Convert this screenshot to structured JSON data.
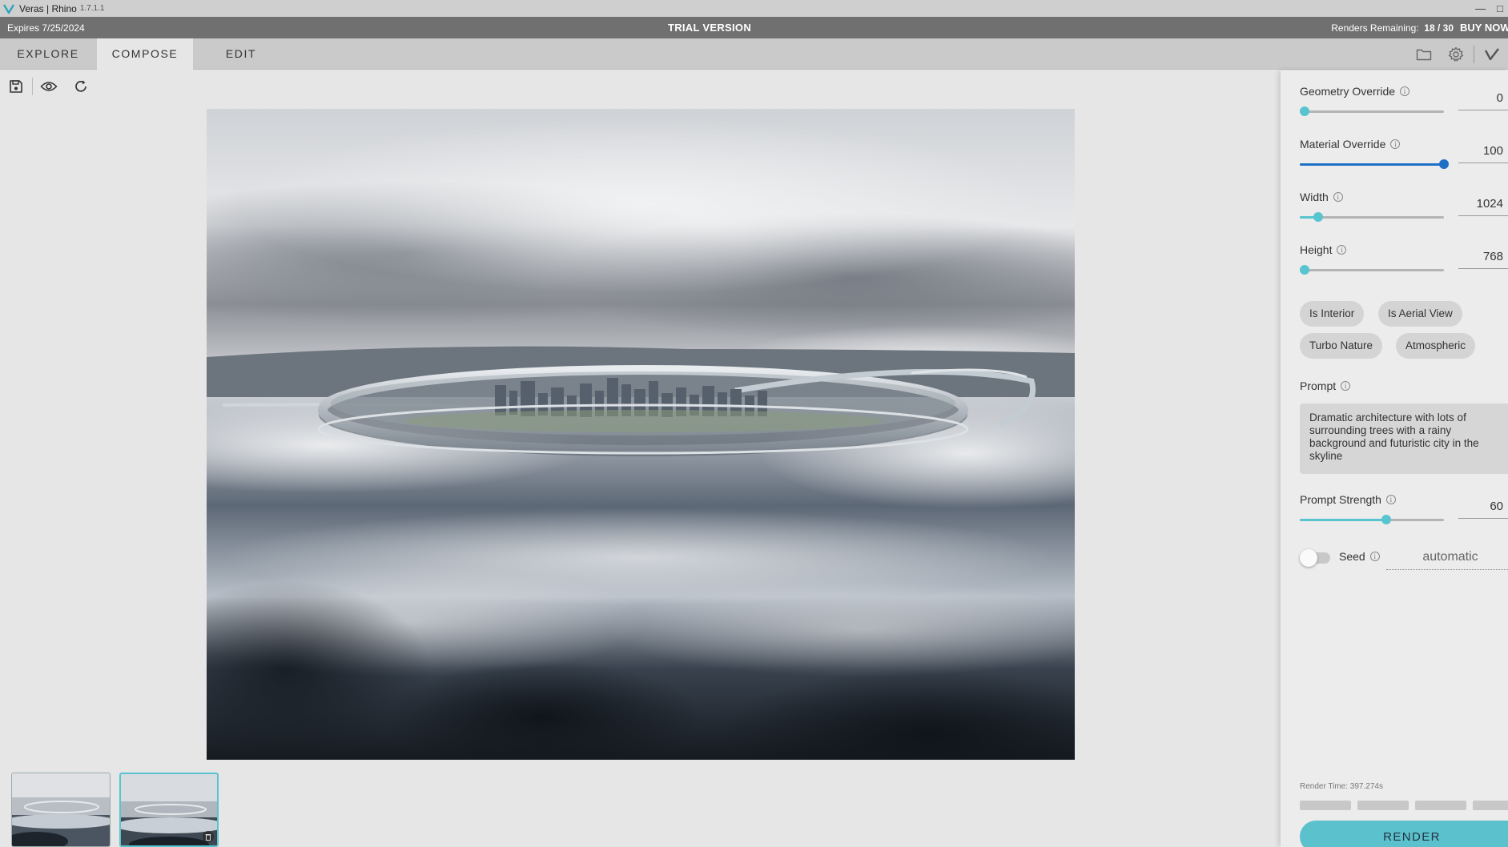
{
  "window": {
    "app_title": "Veras | Rhino",
    "app_version": "1.7.1.1",
    "minimize_glyph": "—",
    "maximize_glyph": "□"
  },
  "trial_bar": {
    "expires": "Expires 7/25/2024",
    "trial_label": "TRIAL VERSION",
    "renders_label": "Renders Remaining:",
    "renders_value": "18 / 30",
    "buy_now": "BUY NOW"
  },
  "tabs": [
    {
      "label": "EXPLORE",
      "active": false
    },
    {
      "label": "COMPOSE",
      "active": true
    },
    {
      "label": "EDIT",
      "active": false
    }
  ],
  "header_icons": [
    "folder-icon",
    "gear-icon",
    "check-icon"
  ],
  "toolbar_icons": [
    "save-icon",
    "eye-icon",
    "refresh-icon"
  ],
  "thumbnails": [
    {
      "name": "render-thumbnail-1",
      "selected": false
    },
    {
      "name": "render-thumbnail-2",
      "selected": true
    }
  ],
  "panel": {
    "geometry_override": {
      "label": "Geometry Override",
      "value": "0",
      "fraction": 0.0
    },
    "material_override": {
      "label": "Material Override",
      "value": "100",
      "fraction": 1.0
    },
    "width": {
      "label": "Width",
      "value": "1024",
      "fraction": 0.13
    },
    "height": {
      "label": "Height",
      "value": "768",
      "fraction": 0.0
    },
    "chips": [
      "Is Interior",
      "Is Aerial View",
      "Turbo Nature",
      "Atmospheric"
    ],
    "prompt": {
      "label": "Prompt",
      "value": "Dramatic architecture with lots of surrounding trees with a rainy background and futuristic city in the skyline"
    },
    "prompt_strength": {
      "label": "Prompt Strength",
      "value": "60",
      "fraction": 0.6
    },
    "seed": {
      "label": "Seed",
      "value": "automatic",
      "enabled": false
    },
    "render_time": "Render Time: 397.274s",
    "render_button": "RENDER"
  },
  "colors": {
    "accent_teal": "#57c4cf",
    "accent_blue": "#1f6fc7",
    "trial_bar": "#707070"
  }
}
